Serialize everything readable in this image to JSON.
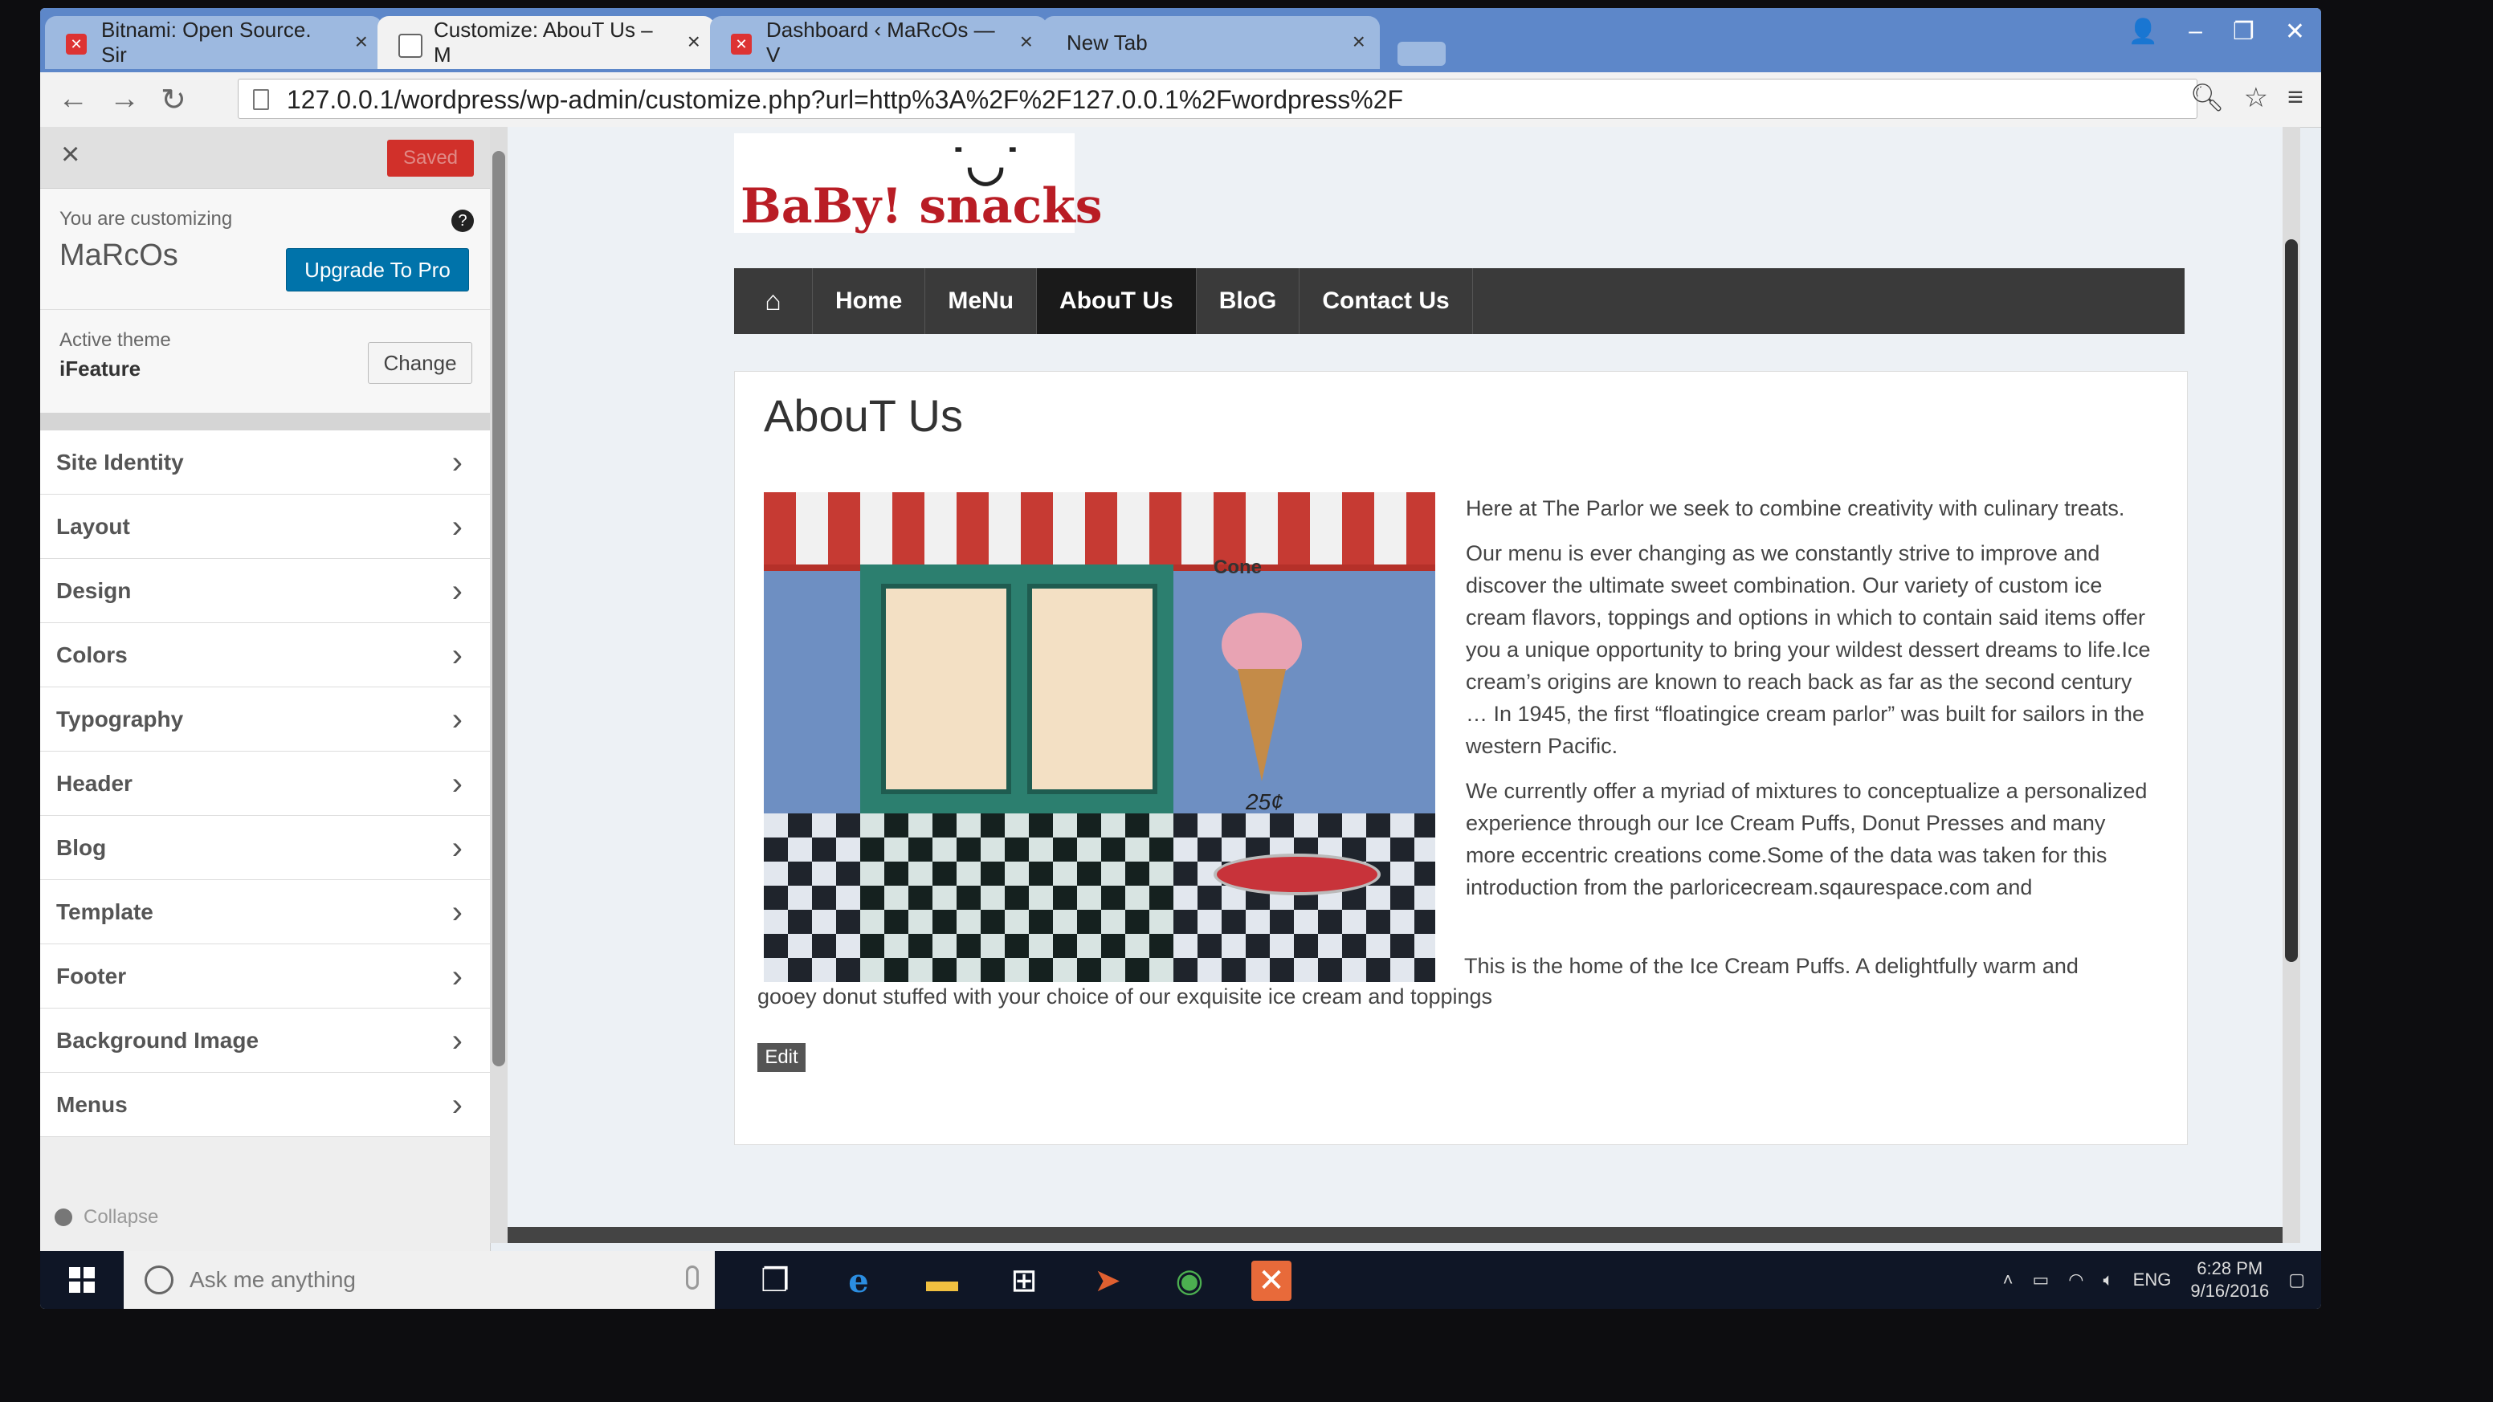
{
  "browser": {
    "tabs": [
      {
        "title": "Bitnami: Open Source. Sir",
        "active": false
      },
      {
        "title": "Customize: AbouT Us – M",
        "active": true
      },
      {
        "title": "Dashboard ‹ MaRcOs — V",
        "active": false
      },
      {
        "title": "New Tab",
        "active": false
      }
    ],
    "url": "127.0.0.1/wordpress/wp-admin/customize.php?url=http%3A%2F%2F127.0.0.1%2Fwordpress%2F"
  },
  "customizer": {
    "saved_label": "Saved",
    "customizing_label": "You are customizing",
    "site_name": "MaRcOs",
    "upgrade_label": "Upgrade To Pro",
    "active_theme_label": "Active theme",
    "theme_name": "iFeature",
    "change_label": "Change",
    "sections": [
      "Site Identity",
      "Layout",
      "Design",
      "Colors",
      "Typography",
      "Header",
      "Blog",
      "Template",
      "Footer",
      "Background Image",
      "Menus"
    ],
    "collapse_label": "Collapse"
  },
  "site": {
    "logo_text": "BaBy! snacks",
    "nav": [
      "Home",
      "MeNu",
      "AbouT Us",
      "BloG",
      "Contact Us"
    ],
    "active_nav": "AbouT Us",
    "page_title": "AbouT Us",
    "image_labels": {
      "cone": "Cone",
      "price": "25¢"
    },
    "paragraphs": [
      "Here at The Parlor we seek to combine creativity with culinary treats.",
      "Our menu is ever changing as we constantly strive to improve and discover the ultimate sweet combination. Our variety of custom ice cream flavors, toppings and options in which to contain said items offer you a unique opportunity to bring your wildest dessert dreams to life.Ice cream’s origins are known to reach back as far as the second century … In 1945, the first “floatingice cream parlor” was built for sailors in the western Pacific.",
      "We currently offer a myriad of mixtures to conceptualize a personalized experience through our Ice Cream Puffs, Donut Presses and many more eccentric creations come.Some of the data was taken for this introduction from the parloricecream.sqaurespace.com and"
    ],
    "closing_line_1": "This is the home of the Ice Cream Puffs. A delightfully warm and",
    "closing_line_2": "gooey donut stuffed with your choice of our exquisite ice cream and toppings",
    "edit_label": "Edit"
  },
  "taskbar": {
    "search_placeholder": "Ask me anything",
    "language": "ENG",
    "time": "6:28 PM",
    "date": "9/16/2016"
  },
  "colors": {
    "accent_red": "#d1302a",
    "wp_blue": "#0073aa",
    "nav_dark": "#3a3a3a"
  }
}
